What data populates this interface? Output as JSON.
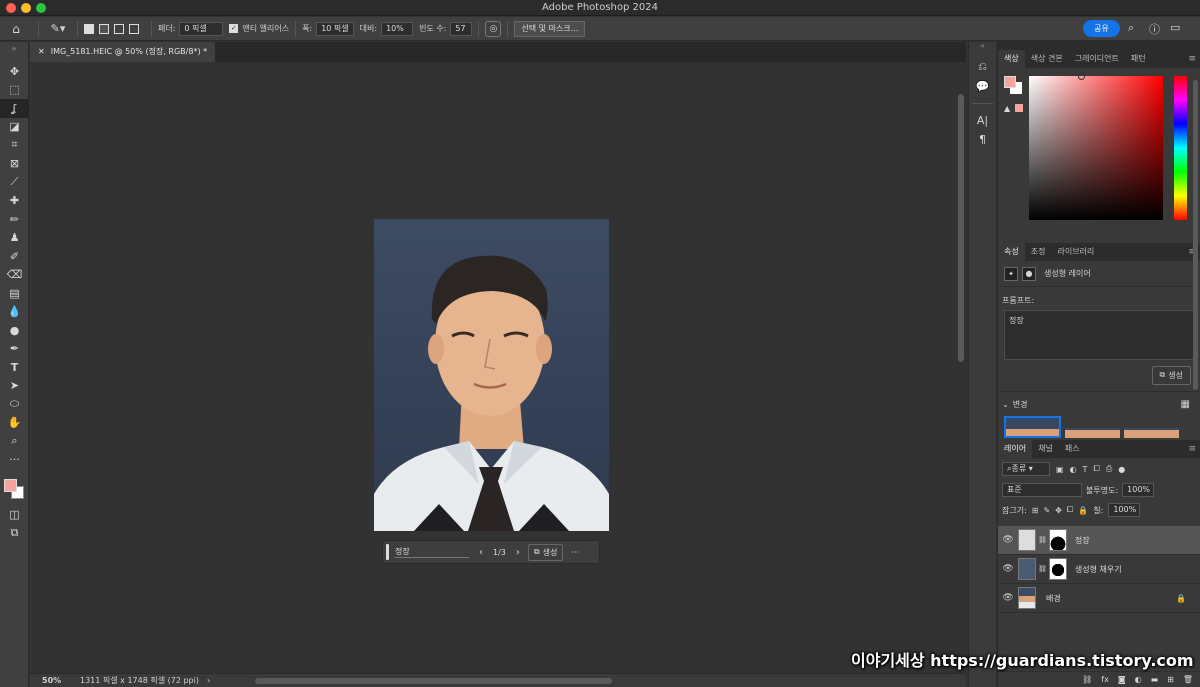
{
  "window": {
    "title": "Adobe Photoshop 2024"
  },
  "options": {
    "feather_label": "페더:",
    "feather_value": "0 픽셀",
    "antialias_label": "앤티 앨리어스",
    "width_label": "폭:",
    "width_value": "10 픽셀",
    "contrast_label": "대비:",
    "contrast_value": "10%",
    "frequency_label": "빈도 수:",
    "frequency_value": "57",
    "select_mask_label": "선택 및 마스크...",
    "share_label": "공유"
  },
  "document": {
    "tab_label": "IMG_5181.HEIC @ 50% (정장, RGB/8*) *"
  },
  "genbar": {
    "prompt": "정장",
    "pager": "1/3",
    "generate_label": "생성",
    "more": "···"
  },
  "status": {
    "zoom": "50%",
    "info": "1311 픽셀 x 1748 픽셀 (72 ppi)"
  },
  "color_panel": {
    "tabs": [
      "색상",
      "색상 견본",
      "그레이디언트",
      "패턴"
    ],
    "foreground": "#f4a49c",
    "background": "#ffffff"
  },
  "properties": {
    "tabs": [
      "속성",
      "조정",
      "라이브러리"
    ],
    "layer_type": "생성형 레이어",
    "prompt_label": "프롬프트:",
    "prompt_text": "정장",
    "generate_label": "생성",
    "variations_label": "변경"
  },
  "layers_panel": {
    "tabs": [
      "레이어",
      "채널",
      "패스"
    ],
    "filter_label": "종류",
    "blend_mode": "표준",
    "opacity_label": "불투명도:",
    "opacity_value": "100%",
    "lock_label": "잠그기:",
    "fill_label": "칠:",
    "fill_value": "100%",
    "layers": [
      {
        "name": "정장",
        "selected": true
      },
      {
        "name": "생성형 채우기",
        "selected": false
      },
      {
        "name": "배경",
        "selected": false
      }
    ]
  },
  "watermark": {
    "text": "이야기세상 https://guardians.tistory.com"
  }
}
